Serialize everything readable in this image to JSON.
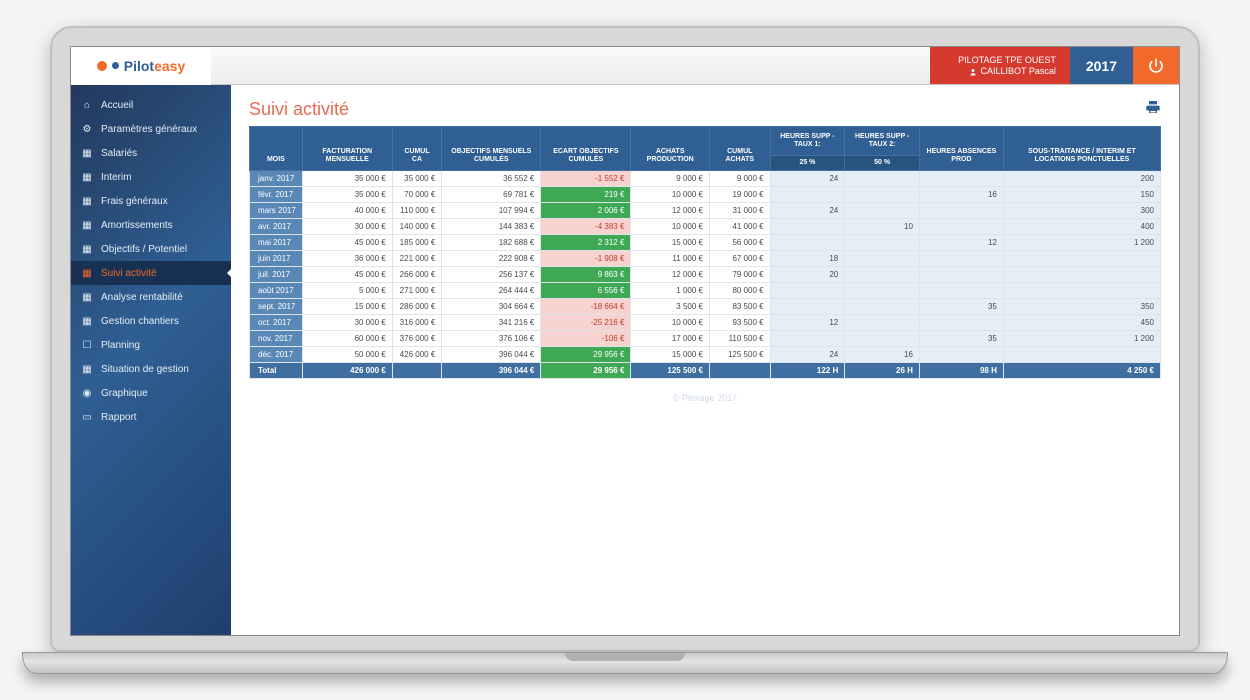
{
  "app": {
    "logo_text_1": "Pilot",
    "logo_text_2": "easy"
  },
  "header": {
    "org_name": "PILOTAGE TPE OUEST",
    "user_name": "CAILLIBOT Pascal",
    "year": "2017"
  },
  "sidebar": {
    "items": [
      {
        "icon": "home",
        "label": "Accueil"
      },
      {
        "icon": "gears",
        "label": "Paramètres généraux"
      },
      {
        "icon": "grid",
        "label": "Salariés"
      },
      {
        "icon": "grid",
        "label": "Interim"
      },
      {
        "icon": "grid",
        "label": "Frais généraux"
      },
      {
        "icon": "grid",
        "label": "Amortissements"
      },
      {
        "icon": "grid",
        "label": "Objectifs / Potentiel"
      },
      {
        "icon": "grid",
        "label": "Suivi activité"
      },
      {
        "icon": "grid",
        "label": "Analyse rentabilité"
      },
      {
        "icon": "grid",
        "label": "Gestion chantiers"
      },
      {
        "icon": "calendar",
        "label": "Planning"
      },
      {
        "icon": "grid",
        "label": "Situation de gestion"
      },
      {
        "icon": "globe",
        "label": "Graphique"
      },
      {
        "icon": "briefcase",
        "label": "Rapport"
      }
    ],
    "active_index": 7
  },
  "page": {
    "title": "Suivi activité"
  },
  "table": {
    "columns": [
      "MOIS",
      "FACTURATION MENSUELLE",
      "CUMUL CA",
      "OBJECTIFS MENSUELS CUMULÉS",
      "ECART OBJECTIFS CUMULÉS",
      "ACHATS PRODUCTION",
      "CUMUL ACHATS",
      "HEURES SUPP - TAUX 1:",
      "HEURES SUPP - TAUX 2:",
      "HEURES ABSENCES PROD",
      "SOUS-TRAITANCE / INTERIM ET LOCATIONS PONCTUELLES"
    ],
    "sub_headers": {
      "taux1": "25 %",
      "taux2": "50 %"
    },
    "rows": [
      {
        "mois": "janv. 2017",
        "fact": "35 000 €",
        "cumul_ca": "35 000 €",
        "obj": "36 552 €",
        "ecart": "-1 552 €",
        "ecart_cls": "neg",
        "achats": "9 000 €",
        "cumul_ach": "9 000 €",
        "h1": "24",
        "h2": "",
        "habs": "",
        "st": "200"
      },
      {
        "mois": "févr. 2017",
        "fact": "35 000 €",
        "cumul_ca": "70 000 €",
        "obj": "69 781 €",
        "ecart": "219 €",
        "ecart_cls": "pos",
        "achats": "10 000 €",
        "cumul_ach": "19 000 €",
        "h1": "",
        "h2": "",
        "habs": "16",
        "st": "150"
      },
      {
        "mois": "mars 2017",
        "fact": "40 000 €",
        "cumul_ca": "110 000 €",
        "obj": "107 994 €",
        "ecart": "2 006 €",
        "ecart_cls": "pos",
        "achats": "12 000 €",
        "cumul_ach": "31 000 €",
        "h1": "24",
        "h2": "",
        "habs": "",
        "st": "300"
      },
      {
        "mois": "avr. 2017",
        "fact": "30 000 €",
        "cumul_ca": "140 000 €",
        "obj": "144 383 €",
        "ecart": "-4 383 €",
        "ecart_cls": "neg",
        "achats": "10 000 €",
        "cumul_ach": "41 000 €",
        "h1": "",
        "h2": "10",
        "habs": "",
        "st": "400"
      },
      {
        "mois": "mai 2017",
        "fact": "45 000 €",
        "cumul_ca": "185 000 €",
        "obj": "182 688 €",
        "ecart": "2 312 €",
        "ecart_cls": "pos",
        "achats": "15 000 €",
        "cumul_ach": "56 000 €",
        "h1": "",
        "h2": "",
        "habs": "12",
        "st": "1 200"
      },
      {
        "mois": "juin 2017",
        "fact": "36 000 €",
        "cumul_ca": "221 000 €",
        "obj": "222 908 €",
        "ecart": "-1 908 €",
        "ecart_cls": "neg",
        "achats": "11 000 €",
        "cumul_ach": "67 000 €",
        "h1": "18",
        "h2": "",
        "habs": "",
        "st": ""
      },
      {
        "mois": "juil. 2017",
        "fact": "45 000 €",
        "cumul_ca": "266 000 €",
        "obj": "256 137 €",
        "ecart": "9 863 €",
        "ecart_cls": "pos",
        "achats": "12 000 €",
        "cumul_ach": "79 000 €",
        "h1": "20",
        "h2": "",
        "habs": "",
        "st": ""
      },
      {
        "mois": "août 2017",
        "fact": "5 000 €",
        "cumul_ca": "271 000 €",
        "obj": "264 444 €",
        "ecart": "6 556 €",
        "ecart_cls": "pos",
        "achats": "1 000 €",
        "cumul_ach": "80 000 €",
        "h1": "",
        "h2": "",
        "habs": "",
        "st": ""
      },
      {
        "mois": "sept. 2017",
        "fact": "15 000 €",
        "cumul_ca": "286 000 €",
        "obj": "304 664 €",
        "ecart": "-18 664 €",
        "ecart_cls": "neg",
        "achats": "3 500 €",
        "cumul_ach": "83 500 €",
        "h1": "",
        "h2": "",
        "habs": "35",
        "st": "350"
      },
      {
        "mois": "oct. 2017",
        "fact": "30 000 €",
        "cumul_ca": "316 000 €",
        "obj": "341 216 €",
        "ecart": "-25 216 €",
        "ecart_cls": "neg",
        "achats": "10 000 €",
        "cumul_ach": "93 500 €",
        "h1": "12",
        "h2": "",
        "habs": "",
        "st": "450"
      },
      {
        "mois": "nov. 2017",
        "fact": "60 000 €",
        "cumul_ca": "376 000 €",
        "obj": "376 106 €",
        "ecart": "-106 €",
        "ecart_cls": "neg",
        "achats": "17 000 €",
        "cumul_ach": "110 500 €",
        "h1": "",
        "h2": "",
        "habs": "35",
        "st": "1 200"
      },
      {
        "mois": "déc. 2017",
        "fact": "50 000 €",
        "cumul_ca": "426 000 €",
        "obj": "396 044 €",
        "ecart": "29 956 €",
        "ecart_cls": "pos",
        "achats": "15 000 €",
        "cumul_ach": "125 500 €",
        "h1": "24",
        "h2": "16",
        "habs": "",
        "st": ""
      }
    ],
    "total": {
      "mois": "Total",
      "fact": "426 000 €",
      "cumul_ca": "",
      "obj": "396 044 €",
      "ecart": "29 956 €",
      "ecart_cls": "pos",
      "achats": "125 500 €",
      "cumul_ach": "",
      "h1": "122 H",
      "h2": "26 H",
      "habs": "98 H",
      "st": "4 250 €"
    }
  },
  "footer": {
    "copyright": "© Pilotage 2017"
  }
}
